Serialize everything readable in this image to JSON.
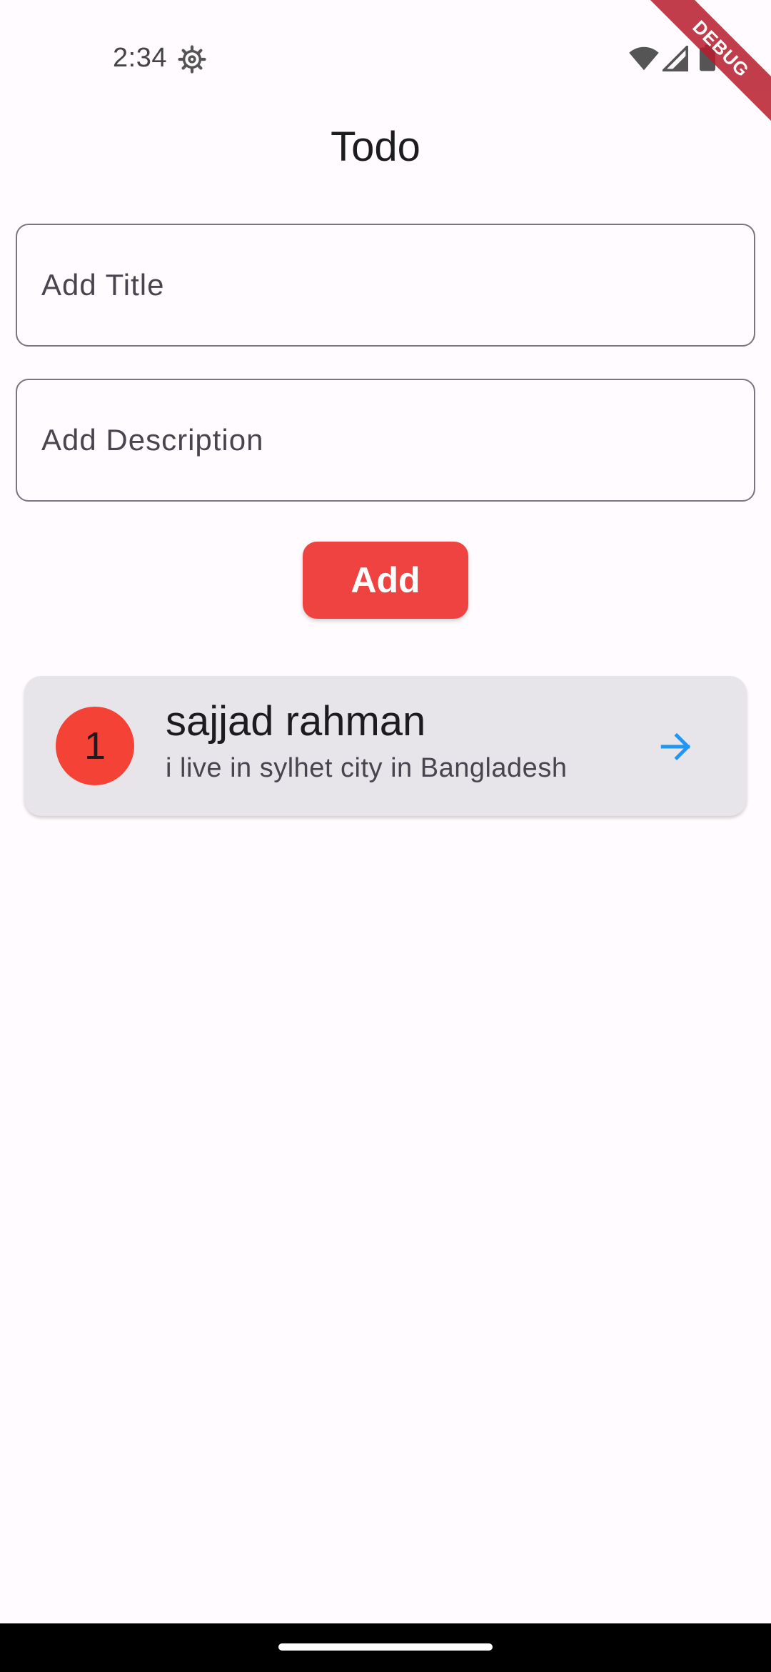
{
  "status_bar": {
    "time": "2:34",
    "gear_icon": "settings-gear-icon",
    "wifi_icon": "wifi-icon",
    "signal_icon": "cell-signal-icon",
    "battery_icon": "battery-icon"
  },
  "debug_banner": {
    "label": "DEBUG",
    "color": "#b71c2c"
  },
  "app_bar": {
    "title": "Todo"
  },
  "form": {
    "title_placeholder": "Add Title",
    "title_value": "",
    "description_placeholder": "Add Description",
    "description_value": "",
    "add_label": "Add",
    "add_color": "#ee4340"
  },
  "todos": [
    {
      "index": "1",
      "title": "sajjad rahman",
      "description": "i live in sylhet city in Bangladesh",
      "avatar_color": "#f44336",
      "arrow_icon": "arrow-forward-icon",
      "arrow_color": "#2196f3"
    }
  ],
  "colors": {
    "background": "#fffbfe",
    "card": "#e7e5ea",
    "outline": "#79747e"
  }
}
